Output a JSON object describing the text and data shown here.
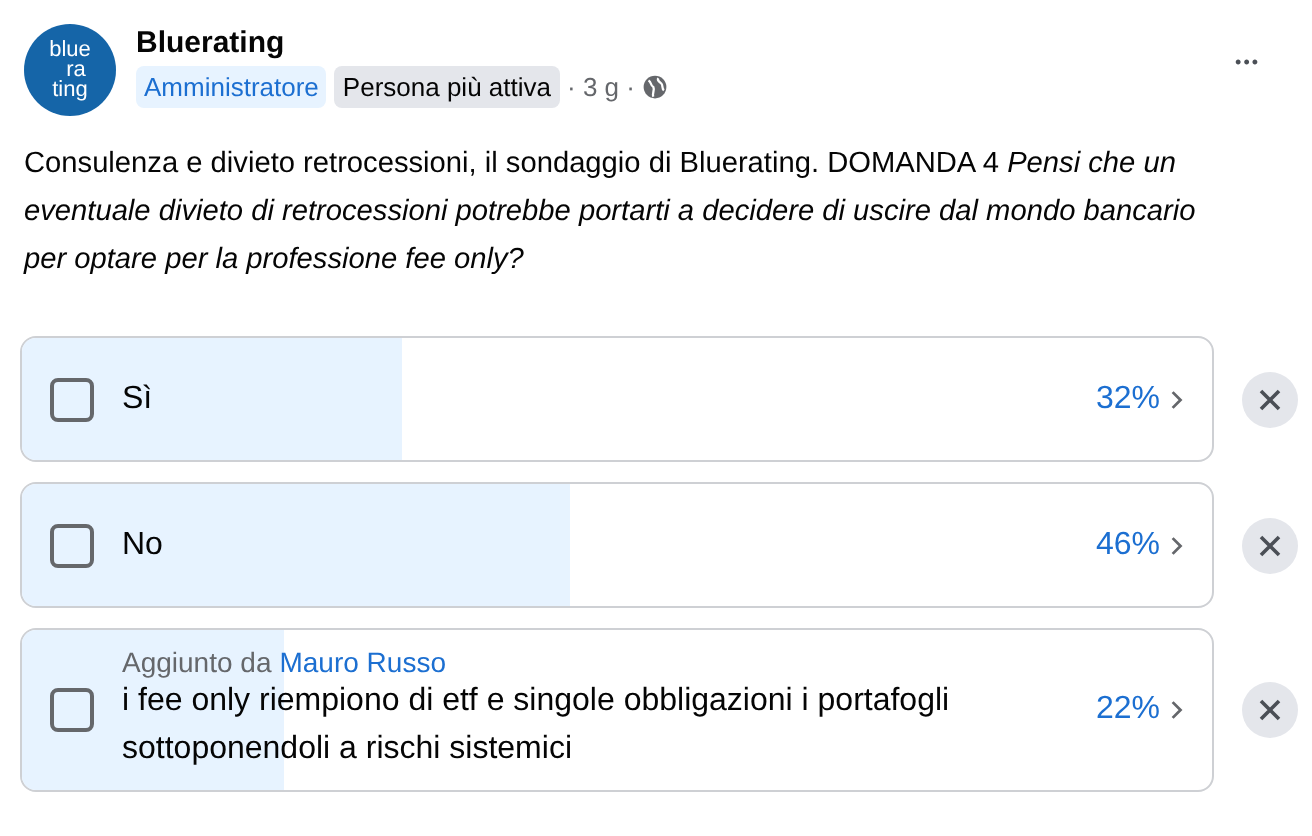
{
  "post": {
    "author": "Bluerating",
    "avatar_lines": [
      "blue",
      "ra",
      "ting"
    ],
    "badges": [
      {
        "label": "Amministratore",
        "kind": "role"
      },
      {
        "label": "Persona più attiva",
        "kind": "activity"
      }
    ],
    "time": "· 3 g ·",
    "menu": "•••",
    "text": "Consulenza e divieto retrocessioni, il sondaggio di Bluerating. DOMANDA 4 *Pensi che un eventuale divieto di retrocessioni potrebbe portarti a decidere di uscire dal mondo bancario per optare per la professione fee only?*"
  },
  "poll": {
    "options": [
      {
        "label": "Sì",
        "percent": "32%",
        "level": 0.32,
        "checked": false
      },
      {
        "label": "No",
        "percent": "46%",
        "level": 0.46,
        "checked": false
      },
      {
        "label": "i fee only riempiono di etf e singole obbligazioni i portafogli sottoponendoli a rischi sistemici",
        "percent": "22%",
        "level": 0.22,
        "checked": false,
        "added_by_prefix": "Aggiunto da",
        "added_by": "Mauro Russo"
      }
    ]
  }
}
